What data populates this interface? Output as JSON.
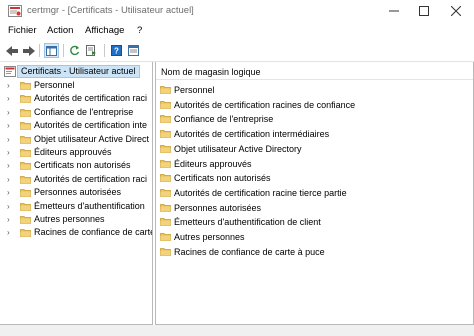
{
  "window": {
    "title": "certmgr - [Certificats - Utilisateur actuel]"
  },
  "menu": [
    "Fichier",
    "Action",
    "Affichage",
    "?"
  ],
  "tree": {
    "root": "Certificats - Utilisateur actuel",
    "items": [
      "Personnel",
      "Autorités de certification raci",
      "Confiance de l'entreprise",
      "Autorités de certification inte",
      "Objet utilisateur Active Direct",
      "Éditeurs approuvés",
      "Certificats non autorisés",
      "Autorités de certification raci",
      "Personnes autorisées",
      "Émetteurs d'authentification",
      "Autres personnes",
      "Racines de confiance de carte"
    ]
  },
  "list": {
    "column_header": "Nom de magasin logique",
    "items": [
      "Personnel",
      "Autorités de certification racines de confiance",
      "Confiance de l'entreprise",
      "Autorités de certification intermédiaires",
      "Objet utilisateur Active Directory",
      "Éditeurs approuvés",
      "Certificats non autorisés",
      "Autorités de certification racine tierce partie",
      "Personnes autorisées",
      "Émetteurs d'authentification de client",
      "Autres personnes",
      "Racines de confiance de carte à puce"
    ]
  },
  "colors": {
    "folder": "#e8c35a",
    "selection": "#cce4f7",
    "accent": "#1e6fc5"
  }
}
